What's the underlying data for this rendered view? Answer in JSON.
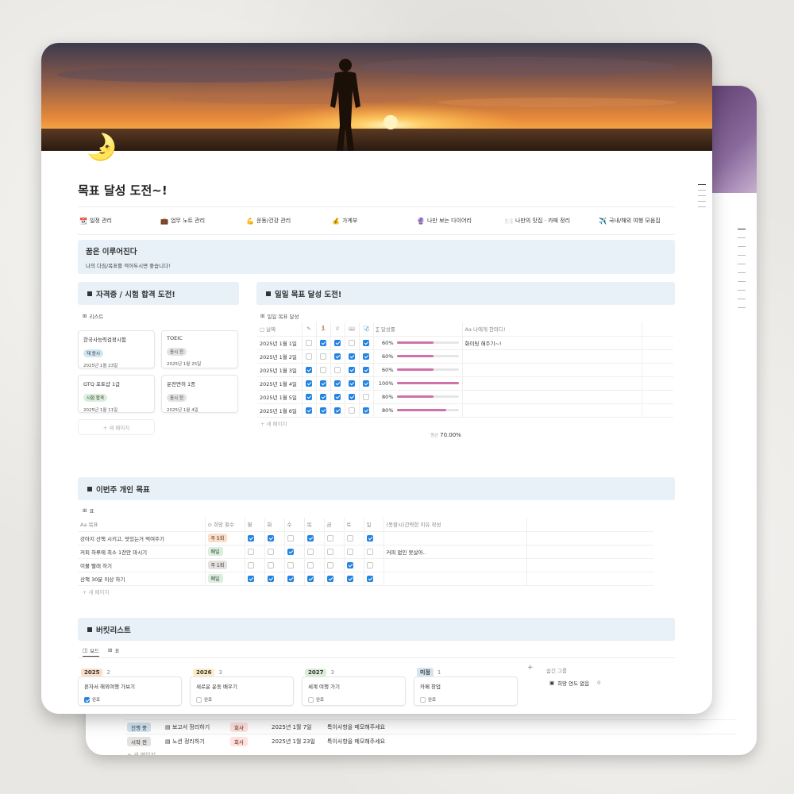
{
  "back_page": {
    "rows": [
      {
        "status": "진행 중",
        "task": "보고서 정리하기",
        "category": "회사",
        "date": "2025년 1월 7일",
        "note": "특이사항을 메모해주세요"
      },
      {
        "status": "시작 전",
        "task": "노션 정리하기",
        "category": "회사",
        "date": "2025년 1월 23일",
        "note": "특이사항을 메모해주세요"
      }
    ],
    "new_page": "+ 새 페이지"
  },
  "page": {
    "icon": "🌛",
    "title": "목표 달성 도전~!"
  },
  "nav": [
    {
      "icon": "📆",
      "label": "일정 관리"
    },
    {
      "icon": "💼",
      "label": "업무 노트 관리"
    },
    {
      "icon": "💪",
      "label": "운동/건강 관리"
    },
    {
      "icon": "💰",
      "label": "가계부"
    },
    {
      "icon": "🔮",
      "label": "나만 보는 다이어리"
    },
    {
      "icon": "🍽️",
      "label": "나만의 맛집 · 카페 정리"
    },
    {
      "icon": "✈️",
      "label": "국내/해외 여행 모음집"
    }
  ],
  "callout": {
    "title": "꿈은 이루어진다",
    "subtitle": "나의 다짐/목표를 적어두시면 좋습니다!"
  },
  "cert": {
    "header": "자격증 / 시험 합격 도전!",
    "view": "리스트",
    "cards": [
      {
        "title": "한국사능력검정시험",
        "tag": "재 응시",
        "tag_color": "blue",
        "date": "2025년 1월 23일"
      },
      {
        "title": "TOEIC",
        "tag": "응시 전",
        "tag_color": "gray",
        "date": "2025년 1월 25일"
      },
      {
        "title": "GTQ 포토샵 1급",
        "tag": "시험 합격",
        "tag_color": "green",
        "date": "2025년 1월 11일"
      },
      {
        "title": "운전면허 1종",
        "tag": "응시 전",
        "tag_color": "gray",
        "date": "2025년 1월 4일"
      }
    ],
    "new_page": "+ 새 페이지"
  },
  "daily": {
    "header": "일일 목표 달성 도전!",
    "view": "일일 목표 달성",
    "columns": [
      "날짜",
      "✎",
      "🏃",
      "♕",
      "📖",
      "🩺",
      "∑ 달성률",
      "Aa 나에게 한마디!"
    ],
    "rows": [
      {
        "date": "2025년 1월 1일",
        "checks": [
          false,
          true,
          true,
          false,
          true
        ],
        "rate": "60%",
        "rate_value": 60,
        "note": "화이팅 해주기~!"
      },
      {
        "date": "2025년 1월 2일",
        "checks": [
          false,
          false,
          true,
          true,
          true
        ],
        "rate": "60%",
        "rate_value": 60,
        "note": ""
      },
      {
        "date": "2025년 1월 3일",
        "checks": [
          true,
          false,
          false,
          true,
          true
        ],
        "rate": "60%",
        "rate_value": 60,
        "note": ""
      },
      {
        "date": "2025년 1월 4일",
        "checks": [
          true,
          true,
          true,
          true,
          true
        ],
        "rate": "100%",
        "rate_value": 100,
        "note": ""
      },
      {
        "date": "2025년 1월 5일",
        "checks": [
          true,
          true,
          true,
          true,
          false
        ],
        "rate": "80%",
        "rate_value": 60,
        "note": ""
      },
      {
        "date": "2025년 1월 6일",
        "checks": [
          true,
          true,
          true,
          false,
          true
        ],
        "rate": "80%",
        "rate_value": 80,
        "note": ""
      }
    ],
    "new_page": "+ 새 페이지",
    "avg_label": "평균",
    "avg_value": "70.00%"
  },
  "weekly": {
    "header": "이번주 개인 목표",
    "view": "표",
    "columns": [
      "Aa 목표",
      "⊙ 희망 횟수",
      "월",
      "화",
      "수",
      "목",
      "금",
      "토",
      "일",
      "(못할시)간략한 이유 작성"
    ],
    "rows": [
      {
        "goal": "강아지 산책 시키고, 맛있는거 먹여주기",
        "freq": "주 5회",
        "freq_color": "orange",
        "checks": [
          true,
          true,
          false,
          true,
          false,
          false,
          true
        ],
        "reason": ""
      },
      {
        "goal": "커피 하루에 최소 1잔만 마시기",
        "freq": "매일",
        "freq_color": "green",
        "checks": [
          false,
          false,
          true,
          false,
          false,
          false,
          false
        ],
        "reason": "커피 없인 못살아.."
      },
      {
        "goal": "이불 빨래 하기",
        "freq": "주 1회",
        "freq_color": "gray",
        "checks": [
          false,
          false,
          false,
          false,
          false,
          true,
          false
        ],
        "reason": ""
      },
      {
        "goal": "산책 30분 이상 하기",
        "freq": "매일",
        "freq_color": "green",
        "checks": [
          true,
          true,
          true,
          true,
          true,
          true,
          true
        ],
        "reason": ""
      }
    ],
    "new_page": "+ 새 페이지"
  },
  "bucket": {
    "header": "버킷리스트",
    "tabs": [
      "보드",
      "표"
    ],
    "groups": [
      {
        "label": "2025",
        "count": "2",
        "color": "#fadec9",
        "card": "혼자서 해외여행 가보기",
        "status": "완료",
        "done": true
      },
      {
        "label": "2026",
        "count": "3",
        "color": "#fdecc8",
        "card": "새로운 운동 배우기",
        "status": "완료",
        "done": false
      },
      {
        "label": "2027",
        "count": "3",
        "color": "#dbeddb",
        "card": "세계 여행 가기",
        "status": "완료",
        "done": false
      },
      {
        "label": "미정",
        "count": "1",
        "color": "#d3e5ef",
        "card": "카페 창업",
        "status": "완료",
        "done": false
      }
    ],
    "hidden_group_label": "숨긴 그룹",
    "hidden_item": "희망 연도 없음",
    "hidden_count": "0"
  }
}
